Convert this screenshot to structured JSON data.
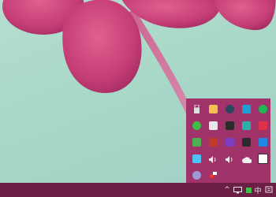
{
  "taskbar": {
    "ime_label": "中",
    "show_hidden_icons": "^",
    "tray_icons": [
      "network-icon",
      "green-app-icon",
      "action-center-icon"
    ]
  },
  "tray_flyout": {
    "background": "#a0346a",
    "icons": [
      {
        "name": "usb-icon",
        "glyph": "",
        "bg": "transparent"
      },
      {
        "name": "shield-security-icon",
        "glyph": "",
        "bg": "#f2c14e"
      },
      {
        "name": "steam-icon",
        "glyph": "",
        "bg": "#2a475e"
      },
      {
        "name": "phone-app-icon",
        "glyph": "",
        "bg": "#1a9fd6"
      },
      {
        "name": "spotify-icon",
        "glyph": "",
        "bg": "#1db954"
      },
      {
        "name": "wechat-icon",
        "glyph": "",
        "bg": "#3fbf4a"
      },
      {
        "name": "document-app-icon",
        "glyph": "",
        "bg": "#e8e8e8"
      },
      {
        "name": "game-app-icon",
        "glyph": "",
        "bg": "#2b2b2b"
      },
      {
        "name": "teal-app-icon",
        "glyph": "",
        "bg": "#2ab0a8"
      },
      {
        "name": "red-app-icon",
        "glyph": "",
        "bg": "#e0334a"
      },
      {
        "name": "green-square-icon",
        "glyph": "",
        "bg": "#4caf50"
      },
      {
        "name": "mail-app-icon",
        "glyph": "",
        "bg": "#c0392b"
      },
      {
        "name": "office-app-icon",
        "glyph": "",
        "bg": "#7b3fc4"
      },
      {
        "name": "nvidia-icon",
        "glyph": "",
        "bg": "#2b2b2b"
      },
      {
        "name": "blue-arrow-icon",
        "glyph": "",
        "bg": "#1e88e5"
      },
      {
        "name": "file-app-icon",
        "glyph": "",
        "bg": "#4fc3f7"
      },
      {
        "name": "volume-icon",
        "glyph": "",
        "bg": "transparent"
      },
      {
        "name": "volume-icon-2",
        "glyph": "",
        "bg": "transparent"
      },
      {
        "name": "cloud-icon",
        "glyph": "",
        "bg": "transparent"
      },
      {
        "name": "warning-app-icon",
        "glyph": "",
        "bg": "#ffffff"
      },
      {
        "name": "skype-icon",
        "glyph": "",
        "bg": "#9e9ad6"
      },
      {
        "name": "tools-app-icon",
        "glyph": "",
        "bg": "transparent"
      }
    ]
  }
}
